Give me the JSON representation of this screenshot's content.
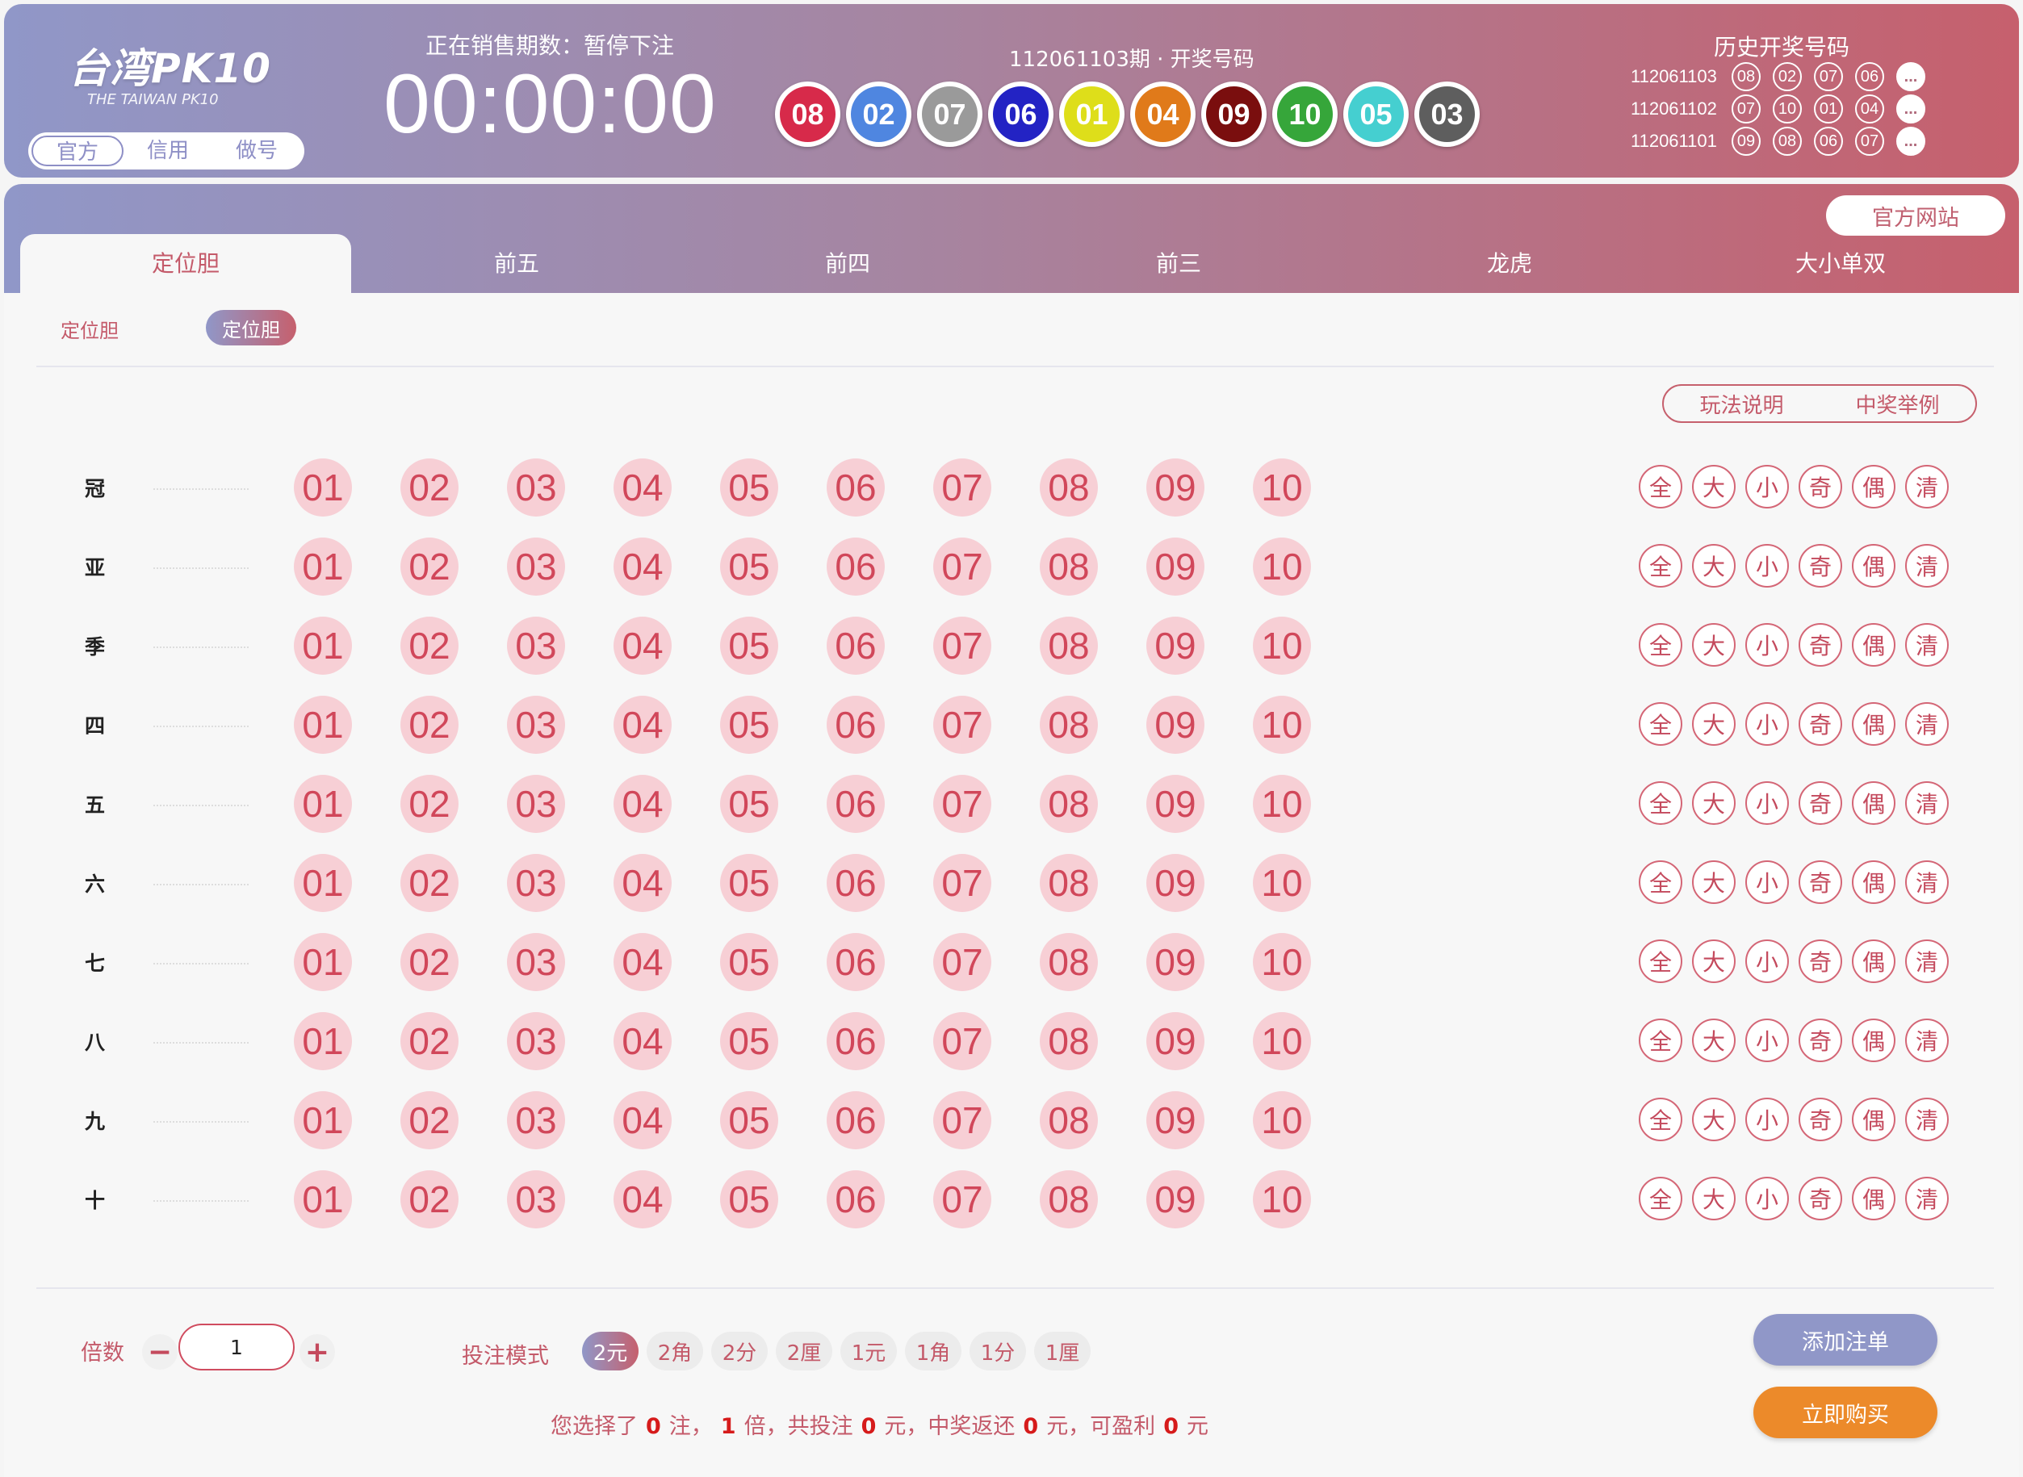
{
  "header": {
    "logo": "台湾PK10",
    "logo_sub": "THE TAIWAN PK10",
    "mode_tabs": [
      "官方",
      "信用",
      "做号"
    ],
    "sale_label": "正在销售期数：暂停下注",
    "countdown": "00:00:00",
    "draw_label": "112061103期 · 开奖号码",
    "draw_numbers": [
      {
        "n": "08",
        "color": "#d72a4a"
      },
      {
        "n": "02",
        "color": "#4f86e0"
      },
      {
        "n": "07",
        "color": "#9a9a9a"
      },
      {
        "n": "06",
        "color": "#2323c4"
      },
      {
        "n": "01",
        "color": "#dede1a"
      },
      {
        "n": "04",
        "color": "#e07a1a"
      },
      {
        "n": "09",
        "color": "#7a0e0e"
      },
      {
        "n": "10",
        "color": "#36a63a"
      },
      {
        "n": "05",
        "color": "#45cfd0"
      },
      {
        "n": "03",
        "color": "#5e5e5e"
      }
    ],
    "history_title": "历史开奖号码",
    "history": [
      {
        "id": "112061103",
        "nums": [
          "08",
          "02",
          "07",
          "06"
        ],
        "more": "..."
      },
      {
        "id": "112061102",
        "nums": [
          "07",
          "10",
          "01",
          "04"
        ],
        "more": "..."
      },
      {
        "id": "112061101",
        "nums": [
          "09",
          "08",
          "06",
          "07"
        ],
        "more": "..."
      }
    ]
  },
  "panel": {
    "official_site": "官方网站",
    "tabs": [
      "定位胆",
      "前五",
      "前四",
      "前三",
      "龙虎",
      "大小单双"
    ],
    "sub_label": "定位胆",
    "sub_option": "定位胆",
    "rules_buttons": [
      "玩法说明",
      "中奖举例"
    ],
    "positions": [
      "冠",
      "亚",
      "季",
      "四",
      "五",
      "六",
      "七",
      "八",
      "九",
      "十"
    ],
    "numbers": [
      "01",
      "02",
      "03",
      "04",
      "05",
      "06",
      "07",
      "08",
      "09",
      "10"
    ],
    "quick_buttons": [
      "全",
      "大",
      "小",
      "奇",
      "偶",
      "清"
    ]
  },
  "footer": {
    "multiplier_label": "倍数",
    "minus": "−",
    "plus": "+",
    "multiplier_value": "1",
    "mode_label": "投注模式",
    "units": [
      "2元",
      "2角",
      "2分",
      "2厘",
      "1元",
      "1角",
      "1分",
      "1厘"
    ],
    "summary": {
      "p1": "您选择了",
      "bets": "0",
      "p2": "注，",
      "mult": "1",
      "p3": "倍，共投注",
      "total": "0",
      "p4": "元，中奖返还",
      "returned": "0",
      "p5": "元，可盈利",
      "profit": "0",
      "p6": "元"
    },
    "add_button": "添加注单",
    "buy_button": "立即购买",
    "add_color": "#9097c8",
    "buy_color": "#ec8a2a"
  }
}
